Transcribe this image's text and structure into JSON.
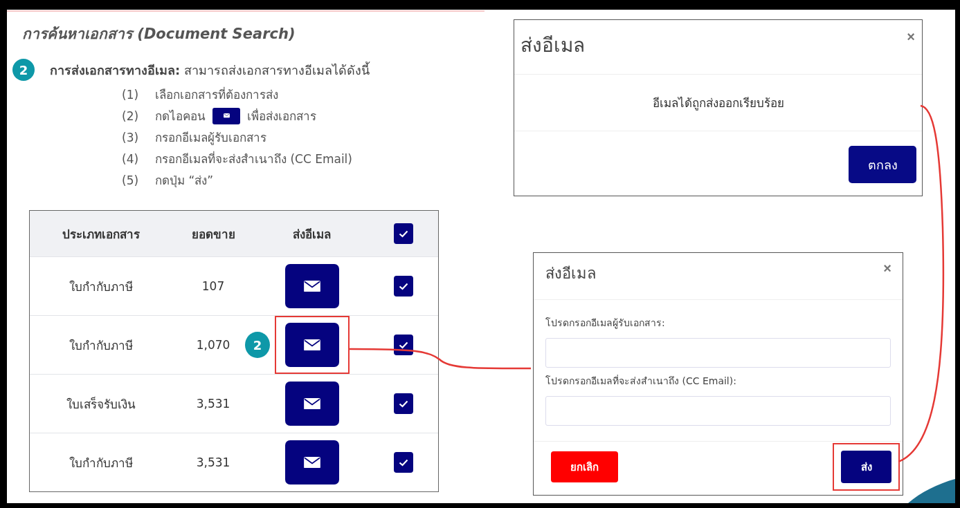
{
  "heading": "การค้นหาเอกสาร (Document Search)",
  "step": {
    "badge": "2",
    "text": "**การส่งเอกสารทางอีเมล:** สามารถส่งเอกสารทางอีเมลได้ดังนี้"
  },
  "instructions": [
    {
      "number": "(1)",
      "text": "เลือกเอกสารที่ต้องการส่ง"
    },
    {
      "number": "(2)",
      "text": "กดไอคอน",
      "text_after": "เพื่อส่งเอกสาร"
    },
    {
      "number": "(3)",
      "text": "กรอกอีเมลผู้รับเอกสาร"
    },
    {
      "number": "(4)",
      "text": "กรอกอีเมลที่จะส่งสำเนาถึง (CC Email)"
    },
    {
      "number": "(5)",
      "text": "กดปุ่ม “ส่ง”"
    }
  ],
  "table": {
    "columns": [
      "ประเภทเอกสาร",
      "ยอดขาย",
      "ส่งอีเมล"
    ],
    "header_checked": true,
    "rows": [
      {
        "type": "ใบกำกับภาษี",
        "amount": "107",
        "checked": true,
        "highlighted": false
      },
      {
        "type": "ใบกำกับภาษี",
        "amount": "1,070",
        "checked": true,
        "highlighted": true,
        "badge": "2"
      },
      {
        "type": "ใบเสร็จรับเงิน",
        "amount": "3,531",
        "checked": true,
        "highlighted": false
      },
      {
        "type": "ใบกำกับภาษี",
        "amount": "3,531",
        "checked": true,
        "highlighted": false
      }
    ]
  },
  "success_dialog": {
    "title": "ส่งอีเมล",
    "close": "×",
    "message": "อีเมลได้ถูกส่งออกเรียบร้อย",
    "ok": "ตกลง"
  },
  "email_dialog": {
    "title": "ส่งอีเมล",
    "close": "×",
    "fields": [
      {
        "label": "โปรดกรอกอีเมลผู้รับเอกสาร:"
      },
      {
        "label": "โปรดกรอกอีเมลที่จะส่งสำเนาถึง (CC Email):"
      }
    ],
    "cancel": "ยกเลิก",
    "send": "ส่ง",
    "send_highlighted": true
  }
}
